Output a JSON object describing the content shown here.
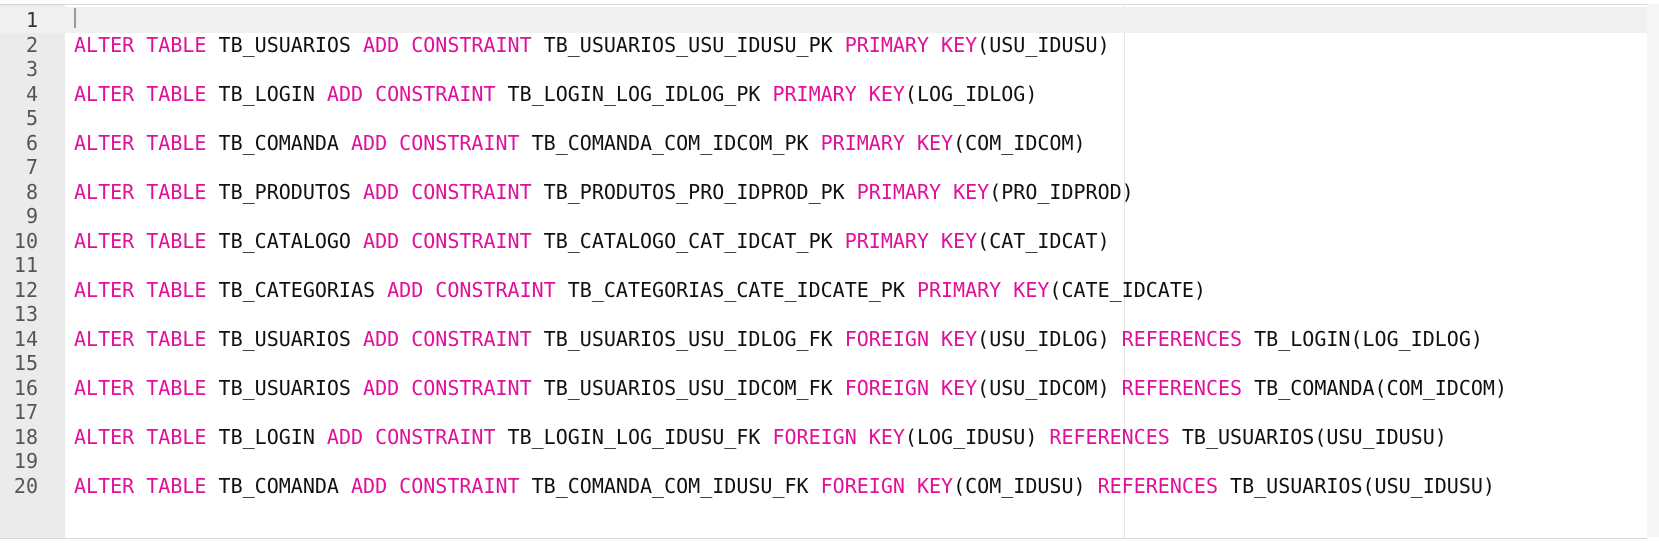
{
  "editor": {
    "language": "sql",
    "colors": {
      "keyword": "#e0109a",
      "text": "#111111",
      "gutter": "#ebebeb",
      "active_line": "#f0f0f0"
    },
    "active_line": 1,
    "lines": [
      {
        "number": "1",
        "tokens": []
      },
      {
        "number": "2",
        "tokens": [
          {
            "t": "ALTER",
            "k": true
          },
          {
            "t": " "
          },
          {
            "t": "TABLE",
            "k": true
          },
          {
            "t": " TB_USUARIOS "
          },
          {
            "t": "ADD",
            "k": true
          },
          {
            "t": " "
          },
          {
            "t": "CONSTRAINT",
            "k": true
          },
          {
            "t": " TB_USUARIOS_USU_IDUSU_PK "
          },
          {
            "t": "PRIMARY",
            "k": true
          },
          {
            "t": " "
          },
          {
            "t": "KEY",
            "k": true
          },
          {
            "t": "(USU_IDUSU)"
          }
        ]
      },
      {
        "number": "3",
        "tokens": []
      },
      {
        "number": "4",
        "tokens": [
          {
            "t": "ALTER",
            "k": true
          },
          {
            "t": " "
          },
          {
            "t": "TABLE",
            "k": true
          },
          {
            "t": " TB_LOGIN "
          },
          {
            "t": "ADD",
            "k": true
          },
          {
            "t": " "
          },
          {
            "t": "CONSTRAINT",
            "k": true
          },
          {
            "t": " TB_LOGIN_LOG_IDLOG_PK "
          },
          {
            "t": "PRIMARY",
            "k": true
          },
          {
            "t": " "
          },
          {
            "t": "KEY",
            "k": true
          },
          {
            "t": "(LOG_IDLOG)"
          }
        ]
      },
      {
        "number": "5",
        "tokens": []
      },
      {
        "number": "6",
        "tokens": [
          {
            "t": "ALTER",
            "k": true
          },
          {
            "t": " "
          },
          {
            "t": "TABLE",
            "k": true
          },
          {
            "t": " TB_COMANDA "
          },
          {
            "t": "ADD",
            "k": true
          },
          {
            "t": " "
          },
          {
            "t": "CONSTRAINT",
            "k": true
          },
          {
            "t": " TB_COMANDA_COM_IDCOM_PK "
          },
          {
            "t": "PRIMARY",
            "k": true
          },
          {
            "t": " "
          },
          {
            "t": "KEY",
            "k": true
          },
          {
            "t": "(COM_IDCOM)"
          }
        ]
      },
      {
        "number": "7",
        "tokens": []
      },
      {
        "number": "8",
        "tokens": [
          {
            "t": "ALTER",
            "k": true
          },
          {
            "t": " "
          },
          {
            "t": "TABLE",
            "k": true
          },
          {
            "t": " TB_PRODUTOS "
          },
          {
            "t": "ADD",
            "k": true
          },
          {
            "t": " "
          },
          {
            "t": "CONSTRAINT",
            "k": true
          },
          {
            "t": " TB_PRODUTOS_PRO_IDPROD_PK "
          },
          {
            "t": "PRIMARY",
            "k": true
          },
          {
            "t": " "
          },
          {
            "t": "KEY",
            "k": true
          },
          {
            "t": "(PRO_IDPROD)"
          }
        ]
      },
      {
        "number": "9",
        "tokens": []
      },
      {
        "number": "10",
        "tokens": [
          {
            "t": "ALTER",
            "k": true
          },
          {
            "t": " "
          },
          {
            "t": "TABLE",
            "k": true
          },
          {
            "t": " TB_CATALOGO "
          },
          {
            "t": "ADD",
            "k": true
          },
          {
            "t": " "
          },
          {
            "t": "CONSTRAINT",
            "k": true
          },
          {
            "t": " TB_CATALOGO_CAT_IDCAT_PK "
          },
          {
            "t": "PRIMARY",
            "k": true
          },
          {
            "t": " "
          },
          {
            "t": "KEY",
            "k": true
          },
          {
            "t": "(CAT_IDCAT)"
          }
        ]
      },
      {
        "number": "11",
        "tokens": []
      },
      {
        "number": "12",
        "tokens": [
          {
            "t": "ALTER",
            "k": true
          },
          {
            "t": " "
          },
          {
            "t": "TABLE",
            "k": true
          },
          {
            "t": " TB_CATEGORIAS "
          },
          {
            "t": "ADD",
            "k": true
          },
          {
            "t": " "
          },
          {
            "t": "CONSTRAINT",
            "k": true
          },
          {
            "t": " TB_CATEGORIAS_CATE_IDCATE_PK "
          },
          {
            "t": "PRIMARY",
            "k": true
          },
          {
            "t": " "
          },
          {
            "t": "KEY",
            "k": true
          },
          {
            "t": "(CATE_IDCATE)"
          }
        ]
      },
      {
        "number": "13",
        "tokens": []
      },
      {
        "number": "14",
        "tokens": [
          {
            "t": "ALTER",
            "k": true
          },
          {
            "t": " "
          },
          {
            "t": "TABLE",
            "k": true
          },
          {
            "t": " TB_USUARIOS "
          },
          {
            "t": "ADD",
            "k": true
          },
          {
            "t": " "
          },
          {
            "t": "CONSTRAINT",
            "k": true
          },
          {
            "t": " TB_USUARIOS_USU_IDLOG_FK "
          },
          {
            "t": "FOREIGN",
            "k": true
          },
          {
            "t": " "
          },
          {
            "t": "KEY",
            "k": true
          },
          {
            "t": "(USU_IDLOG) "
          },
          {
            "t": "REFERENCES",
            "k": true
          },
          {
            "t": " TB_LOGIN(LOG_IDLOG)"
          }
        ]
      },
      {
        "number": "15",
        "tokens": []
      },
      {
        "number": "16",
        "tokens": [
          {
            "t": "ALTER",
            "k": true
          },
          {
            "t": " "
          },
          {
            "t": "TABLE",
            "k": true
          },
          {
            "t": " TB_USUARIOS "
          },
          {
            "t": "ADD",
            "k": true
          },
          {
            "t": " "
          },
          {
            "t": "CONSTRAINT",
            "k": true
          },
          {
            "t": " TB_USUARIOS_USU_IDCOM_FK "
          },
          {
            "t": "FOREIGN",
            "k": true
          },
          {
            "t": " "
          },
          {
            "t": "KEY",
            "k": true
          },
          {
            "t": "(USU_IDCOM) "
          },
          {
            "t": "REFERENCES",
            "k": true
          },
          {
            "t": " TB_COMANDA(COM_IDCOM)"
          }
        ]
      },
      {
        "number": "17",
        "tokens": []
      },
      {
        "number": "18",
        "tokens": [
          {
            "t": "ALTER",
            "k": true
          },
          {
            "t": " "
          },
          {
            "t": "TABLE",
            "k": true
          },
          {
            "t": " TB_LOGIN "
          },
          {
            "t": "ADD",
            "k": true
          },
          {
            "t": " "
          },
          {
            "t": "CONSTRAINT",
            "k": true
          },
          {
            "t": " TB_LOGIN_LOG_IDUSU_FK "
          },
          {
            "t": "FOREIGN",
            "k": true
          },
          {
            "t": " "
          },
          {
            "t": "KEY",
            "k": true
          },
          {
            "t": "(LOG_IDUSU) "
          },
          {
            "t": "REFERENCES",
            "k": true
          },
          {
            "t": " TB_USUARIOS(USU_IDUSU)"
          }
        ]
      },
      {
        "number": "19",
        "tokens": []
      },
      {
        "number": "20",
        "tokens": [
          {
            "t": "ALTER",
            "k": true
          },
          {
            "t": " "
          },
          {
            "t": "TABLE",
            "k": true
          },
          {
            "t": " TB_COMANDA "
          },
          {
            "t": "ADD",
            "k": true
          },
          {
            "t": " "
          },
          {
            "t": "CONSTRAINT",
            "k": true
          },
          {
            "t": " TB_COMANDA_COM_IDUSU_FK "
          },
          {
            "t": "FOREIGN",
            "k": true
          },
          {
            "t": " "
          },
          {
            "t": "KEY",
            "k": true
          },
          {
            "t": "(COM_IDUSU) "
          },
          {
            "t": "REFERENCES",
            "k": true
          },
          {
            "t": " TB_USUARIOS(USU_IDUSU)"
          }
        ]
      }
    ]
  }
}
